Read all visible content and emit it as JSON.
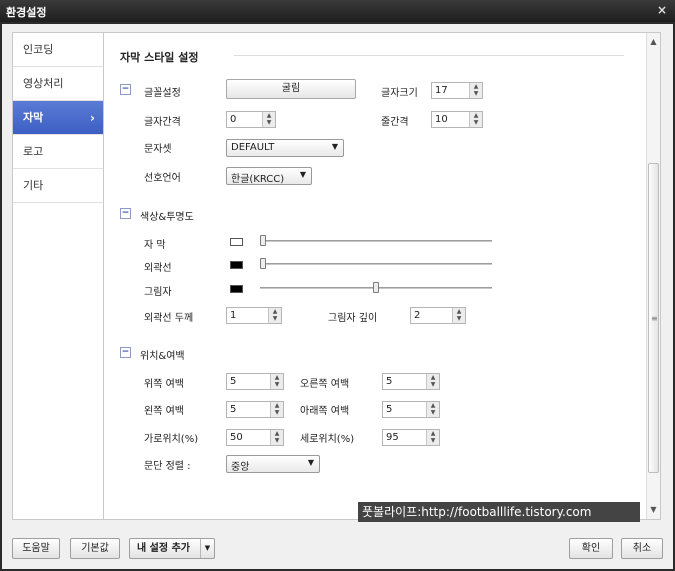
{
  "window": {
    "title": "환경설정",
    "close_glyph": "×"
  },
  "sidebar": {
    "items": [
      {
        "label": "인코딩",
        "active": false
      },
      {
        "label": "영상처리",
        "active": false
      },
      {
        "label": "자막",
        "active": true,
        "arrow": "›"
      },
      {
        "label": "로고",
        "active": false
      },
      {
        "label": "기타",
        "active": false
      }
    ]
  },
  "content": {
    "title": "자막 스타일 설정",
    "font_section": {
      "collapse_glyph": "−",
      "font_label": "글꼴설정",
      "font_button": "굴림",
      "size_label": "글자크기",
      "size_value": "17",
      "spacing_label": "글자간격",
      "spacing_value": "0",
      "line_spacing_label": "줄간격",
      "line_spacing_value": "10",
      "charset_label": "문자셋",
      "charset_value": "DEFAULT",
      "language_label": "선호언어",
      "language_value": "한글(KRCC)"
    },
    "color_section": {
      "collapse_glyph": "−",
      "title": "색상&투명도",
      "subtitle_label": "자    막",
      "outline_label": "외곽선",
      "shadow_label": "그림자",
      "subtitle_color": "#ffffff",
      "outline_color": "#000000",
      "shadow_color": "#000000",
      "subtitle_slider": 0.0,
      "outline_slider": 0.0,
      "shadow_slider": 0.5,
      "outline_thickness_label": "외곽선 두께",
      "outline_thickness_value": "1",
      "shadow_depth_label": "그림자 깊이",
      "shadow_depth_value": "2"
    },
    "position_section": {
      "collapse_glyph": "−",
      "title": "위치&여백",
      "top_margin_label": "위쪽 여백",
      "top_margin_value": "5",
      "right_margin_label": "오른쪽 여백",
      "right_margin_value": "5",
      "left_margin_label": "왼쪽 여백",
      "left_margin_value": "5",
      "bottom_margin_label": "아래쪽 여백",
      "bottom_margin_value": "5",
      "hpos_label": "가로위치(%)",
      "hpos_value": "50",
      "vpos_label": "세로위치(%)",
      "vpos_value": "95",
      "align_label": "문단 정렬 :",
      "align_value": "중앙"
    },
    "watermark": "풋볼라이프:http://footballlife.tistory.com"
  },
  "footer": {
    "help": "도움말",
    "default": "기본값",
    "add_my_setting": "내 설정 추가",
    "ok": "확인",
    "cancel": "취소"
  }
}
